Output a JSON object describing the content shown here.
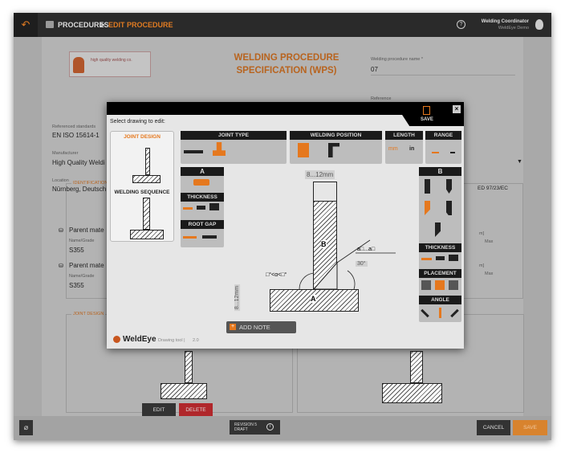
{
  "topbar": {
    "crumb_root": "PROCEDURES",
    "separator": ">",
    "crumb_current": "EDIT PROCEDURE",
    "user_role": "Welding Coordinator",
    "user_org": "WeldEye Demo"
  },
  "logo": {
    "text": "high quality welding co."
  },
  "doc": {
    "title_line1": "WELDING PROCEDURE",
    "title_line2": "SPECIFICATION (WPS)",
    "name_label": "Welding procedure name *",
    "name_value": "07",
    "reference_label": "Reference",
    "standards_label": "Referenced standards",
    "standards_value": "EN ISO 15614-1",
    "manufacturer_label": "Manufacturer",
    "manufacturer_value": "High Quality Weldi",
    "location_label": "Location",
    "location_value": "Nürnberg, Deutsch",
    "directive_value": "ED 97/23/EC",
    "identification_section": "IDENTIFICATION OF",
    "parent1_label": "Parent mate",
    "parent1_grade_label": "Name/Grade",
    "parent1_grade": "S355",
    "parent2_label": "Parent mate",
    "parent2_grade_label": "Name/Grade",
    "parent2_grade": "S355",
    "max1_label": "Max",
    "max2_label": "Max",
    "unit1": "m]",
    "unit2": "m]",
    "joint_design_section": "JOINT DESIGN",
    "edit_label": "EDIT",
    "delete_label": "DELETE"
  },
  "footer": {
    "revision_line1": "REVISION 5",
    "revision_line2": "DRAFT",
    "cancel_label": "CANCEL",
    "save_label": "SAVE"
  },
  "modal": {
    "save_label": "SAVE",
    "select_label": "Select drawing to edit:",
    "thumbs": [
      {
        "label": "JOINT DESIGN"
      },
      {
        "label": "WELDING SEQUENCE"
      }
    ],
    "groups": {
      "joint_type": "JOINT TYPE",
      "welding_position": "WELDING POSITION",
      "length": "LENGTH",
      "range": "RANGE"
    },
    "length_options": [
      "mm",
      "in"
    ],
    "length_selected": "mm",
    "left_panel": {
      "title": "A",
      "thickness": "THICKNESS",
      "root_gap": "ROOT GAP"
    },
    "right_panel": {
      "title": "B",
      "thickness": "THICKNESS",
      "placement": "PLACEMENT",
      "angle": "ANGLE"
    },
    "drawing": {
      "plate_a": "A",
      "plate_b": "B",
      "width_dim": "8...12mm",
      "height_dim": "8...12mm",
      "angle_dim": "30°",
      "weld_dim": "a□...a□",
      "alpha_dim": "□°<α<□°"
    },
    "add_note_label": "ADD NOTE",
    "brand": "WeldEye",
    "tool_label": "Drawing tool |",
    "version": "2.0"
  },
  "colors": {
    "accent": "#e5781e",
    "topbar": "#2a2a2a",
    "delete": "#b0272b"
  }
}
